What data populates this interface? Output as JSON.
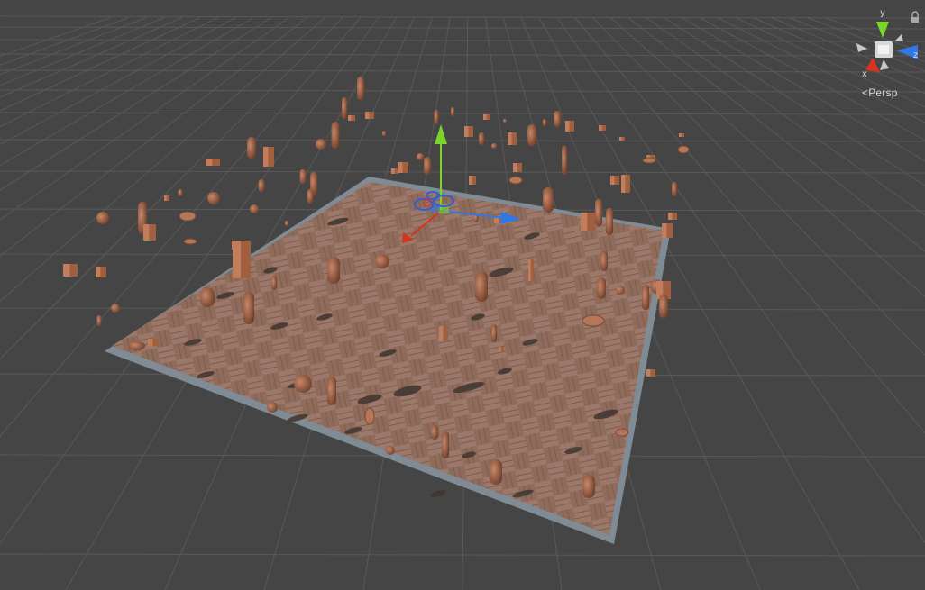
{
  "view": {
    "projection_label": "Persp",
    "axis_labels": {
      "x": "x",
      "y": "y",
      "z": "z"
    }
  },
  "colors": {
    "background": "#454545",
    "grid": "#5a5a5a",
    "floor": "#8e6a5a",
    "floor_edge": "#7c8a96",
    "object": "#a86a48",
    "x_axis": "#d8331f",
    "y_axis": "#7cd32a",
    "z_axis": "#2f78e8"
  },
  "icons": [
    "scene-gizmo-icon",
    "lock-icon",
    "move-tool-gizmo-icon"
  ]
}
